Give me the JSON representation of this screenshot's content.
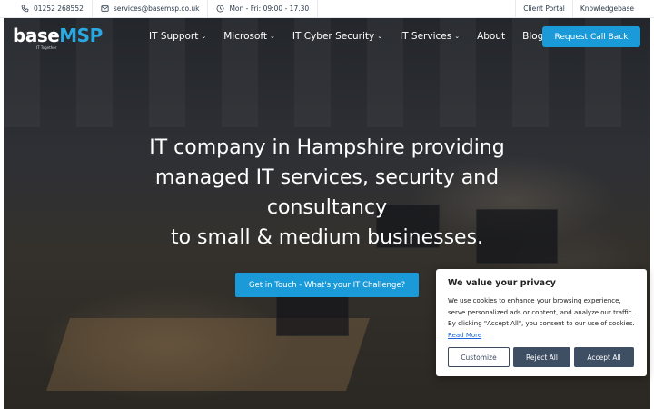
{
  "topbar": {
    "phone": "01252 268552",
    "email": "services@basemsp.co.uk",
    "hours": "Mon - Fri: 09:00 - 17.30",
    "client_portal": "Client Portal",
    "knowledgebase": "Knowledgebase"
  },
  "logo": {
    "base": "base",
    "msp": "MSP",
    "tagline": "IT Together"
  },
  "nav": {
    "items": [
      {
        "label": "IT Support",
        "chevron": "⌄"
      },
      {
        "label": "Microsoft",
        "chevron": "⌄"
      },
      {
        "label": "IT Cyber Security",
        "chevron": "⌄"
      },
      {
        "label": "IT Services",
        "chevron": "⌄"
      },
      {
        "label": "About"
      },
      {
        "label": "Blog"
      }
    ],
    "cta": "Request Call Back"
  },
  "hero": {
    "lines": [
      "IT company in Hampshire providing",
      "managed IT services, security and",
      "consultancy",
      "to small & medium businesses."
    ],
    "button": "Get in Touch - What's your IT Challenge?"
  },
  "cookie": {
    "title": "We value your privacy",
    "text": "We use cookies to enhance your browsing experience, serve personalized ads or content, and analyze our traffic. By clicking \"Accept All\", you consent to our use of cookies.",
    "read_more": "Read More",
    "customize": "Customize",
    "reject": "Reject All",
    "accept": "Accept All"
  },
  "colors": {
    "accent": "#1a9ad8",
    "logo_accent": "#2aa9e0",
    "cookie_button": "#3e4e63",
    "link": "#1863dc"
  }
}
